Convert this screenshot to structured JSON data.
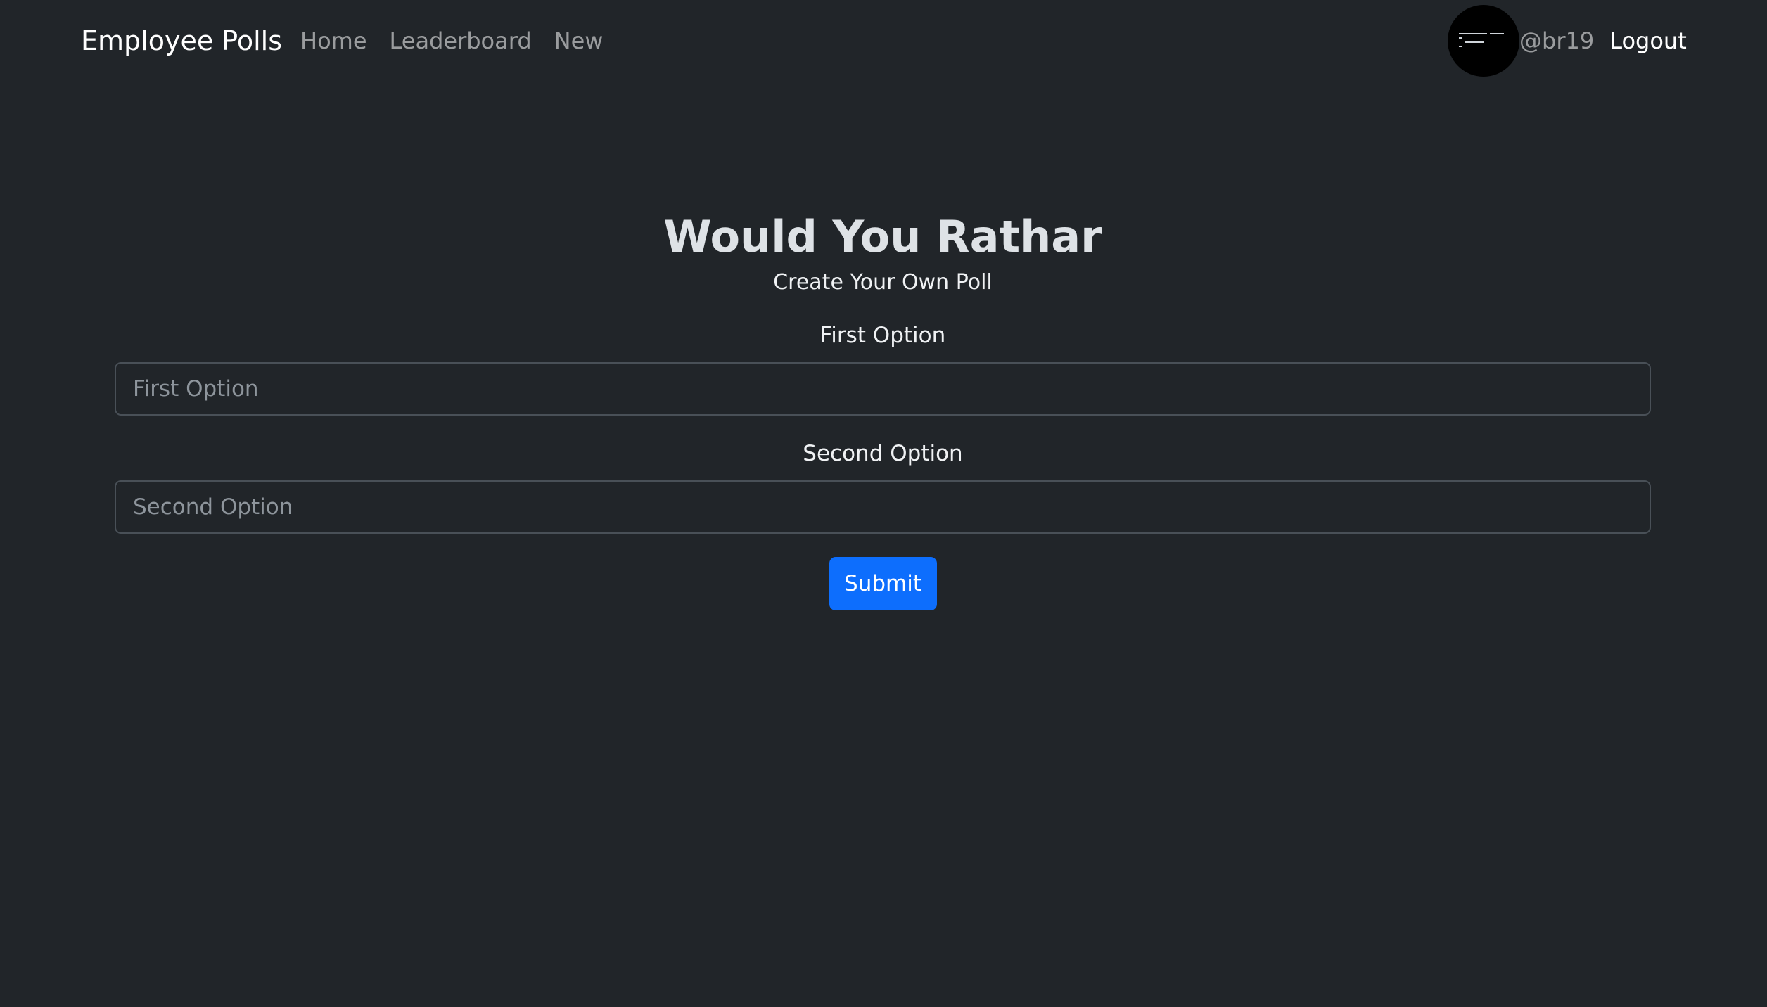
{
  "navbar": {
    "brand": "Employee Polls",
    "links": [
      {
        "label": "Home"
      },
      {
        "label": "Leaderboard"
      },
      {
        "label": "New"
      }
    ],
    "user": {
      "avatar_icon": "code-avatar-icon",
      "username": "@br19",
      "logout_label": "Logout"
    }
  },
  "main": {
    "title": "Would You Rathar",
    "subtitle": "Create Your Own Poll",
    "first_option": {
      "label": "First Option",
      "placeholder": "First Option",
      "value": ""
    },
    "second_option": {
      "label": "Second Option",
      "placeholder": "Second Option",
      "value": ""
    },
    "submit_label": "Submit"
  },
  "colors": {
    "background": "#212529",
    "primary": "#0d6efd",
    "nav_muted": "rgba(255,255,255,0.55)"
  }
}
